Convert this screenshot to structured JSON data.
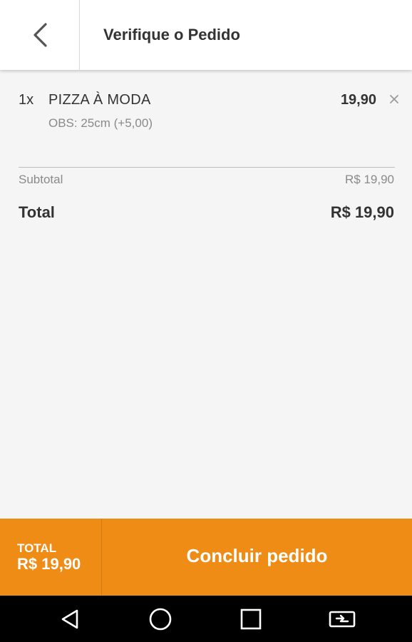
{
  "header": {
    "back_icon": "chevron-left-icon",
    "title": "Verifique o Pedido"
  },
  "order": {
    "items": [
      {
        "quantity": "1x",
        "name": "PIZZA À MODA",
        "obs": "OBS: 25cm (+5,00)",
        "price": "19,90",
        "remove_icon": "close-icon"
      }
    ],
    "subtotal_label": "Subtotal",
    "subtotal_value": "R$ 19,90",
    "total_label": "Total",
    "total_value": "R$ 19,90"
  },
  "bottom_bar": {
    "total_label": "TOTAL",
    "total_value": "R$ 19,90",
    "conclude_label": "Concluir pedido",
    "accent_color": "#ef8c16"
  },
  "nav_bar": {
    "buttons": [
      "back-triangle-icon",
      "home-circle-icon",
      "recents-square-icon",
      "screen-cast-icon"
    ]
  }
}
